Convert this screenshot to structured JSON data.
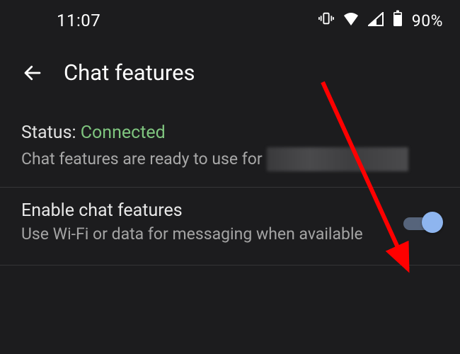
{
  "statusbar": {
    "time": "11:07",
    "battery_percent": "90%"
  },
  "header": {
    "title": "Chat features"
  },
  "status_section": {
    "label": "Status:",
    "value": "Connected",
    "subtitle": "Chat features are ready to use for"
  },
  "settings": {
    "enable_chat": {
      "title": "Enable chat features",
      "subtitle": "Use Wi-Fi or data for messaging when available",
      "enabled": true
    }
  },
  "colors": {
    "bg": "#1c1c1e",
    "status_connected": "#7fc57f",
    "toggle_thumb": "#8eb5ef",
    "toggle_track": "#56647b",
    "annotation": "#ff0000"
  }
}
